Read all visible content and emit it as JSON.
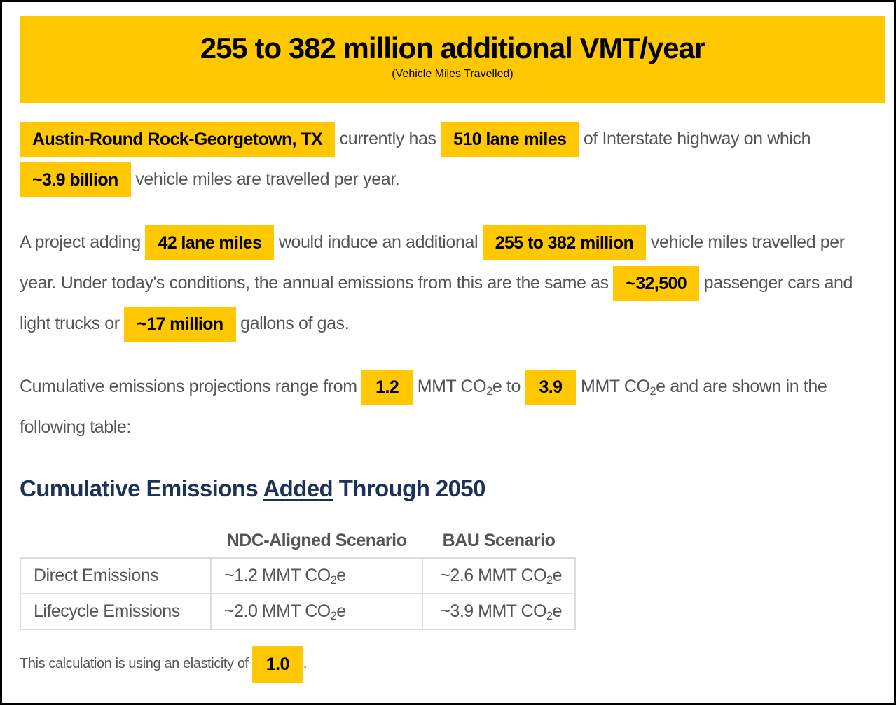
{
  "banner": {
    "title": "255 to 382 million additional VMT/year",
    "subtitle": "(Vehicle Miles Travelled)"
  },
  "colors": {
    "highlight": "#ffc800",
    "heading": "#1c3257",
    "body_text": "#555555",
    "table_border": "#dddddd"
  },
  "paragraph1": {
    "metro_area": "Austin-Round Rock-Georgetown, TX",
    "text1": "currently has",
    "lane_miles": "510 lane miles",
    "text2": "of Interstate highway on which",
    "vmt_current": "~3.9 billion",
    "text3": "vehicle miles are travelled per year."
  },
  "paragraph2": {
    "text1": "A project adding",
    "project_lane_miles": "42 lane miles",
    "text2": "would induce an additional",
    "induced_vmt": "255 to 382 million",
    "text3": "vehicle miles travelled per year. Under today's conditions, the annual emissions from this are the same as",
    "cars": "~32,500",
    "text4": "passenger cars and light trucks or",
    "gallons": "~17 million",
    "text5": "gallons of gas."
  },
  "paragraph3": {
    "text1": "Cumulative emissions projections range from",
    "low": "1.2",
    "unit_a": "MMT CO",
    "unit_sub": "2",
    "unit_b": "e to",
    "high": "3.9",
    "unit_c": "MMT CO",
    "unit_d": "e and are shown in the following table:"
  },
  "section": {
    "title_pre": "Cumulative Emissions ",
    "title_underlined": "Added",
    "title_post": " Through 2050"
  },
  "table": {
    "headers": [
      "",
      "NDC-Aligned Scenario",
      "BAU Scenario"
    ],
    "rows": [
      {
        "label": "Direct Emissions",
        "ndc": "~1.2 MMT CO",
        "bau": "~2.6 MMT CO"
      },
      {
        "label": "Lifecycle Emissions",
        "ndc": "~2.0 MMT CO",
        "bau": "~3.9 MMT CO"
      }
    ],
    "unit_sub": "2",
    "unit_suffix": "e"
  },
  "footnote": {
    "text": "This calculation is using an elasticity of",
    "elasticity": "1.0",
    "period": "."
  }
}
